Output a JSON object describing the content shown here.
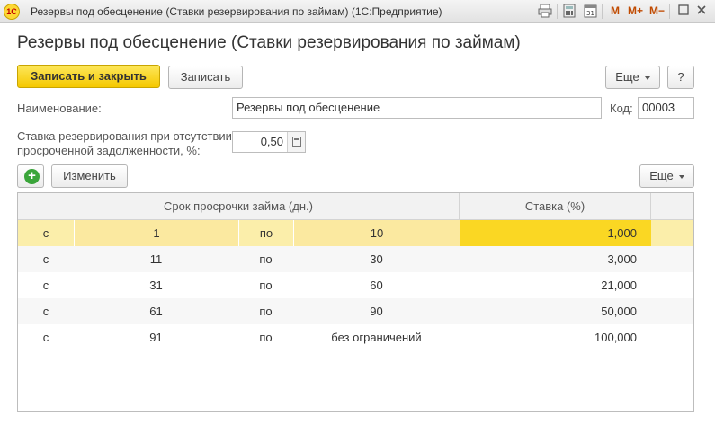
{
  "window": {
    "logo": "1С",
    "title": "Резервы под обесценение (Ставки резервирования по займам)  (1С:Предприятие)",
    "toolbar_icons": [
      "print-icon",
      "calculator-icon",
      "calendar-icon"
    ],
    "m_buttons": [
      "M",
      "M+",
      "M−"
    ],
    "controls": [
      "minimize-icon",
      "close-icon"
    ]
  },
  "form": {
    "title": "Резервы под обесценение (Ставки резервирования по займам)",
    "buttons": {
      "save_close": "Записать и закрыть",
      "save": "Записать",
      "more": "Еще",
      "help": "?"
    },
    "name_label": "Наименование:",
    "name_value": "Резервы под обесценение",
    "code_label": "Код:",
    "code_value": "00003",
    "rate_label_line1": "Ставка резервирования при отсутствии",
    "rate_label_line2": "просроченной задолженности, %:",
    "rate_value": "0,50"
  },
  "table_toolbar": {
    "add": "+",
    "edit": "Изменить",
    "more": "Еще"
  },
  "table": {
    "headers": {
      "period": "Срок просрочки займа (дн.)",
      "rate": "Ставка (%)"
    },
    "rows": [
      {
        "from_label": "с",
        "from": "1",
        "to_label": "по",
        "to": "10",
        "rate": "1,000"
      },
      {
        "from_label": "с",
        "from": "11",
        "to_label": "по",
        "to": "30",
        "rate": "3,000"
      },
      {
        "from_label": "с",
        "from": "31",
        "to_label": "по",
        "to": "60",
        "rate": "21,000"
      },
      {
        "from_label": "с",
        "from": "61",
        "to_label": "по",
        "to": "90",
        "rate": "50,000"
      },
      {
        "from_label": "с",
        "from": "91",
        "to_label": "по",
        "to": "без ограничений",
        "rate": "100,000"
      }
    ],
    "selected_row": 0
  },
  "colors": {
    "primary_button": "#f5c800",
    "selected_row": "#fbeeaa",
    "selected_cell": "#fad723",
    "accent_m": "#c04a00"
  }
}
